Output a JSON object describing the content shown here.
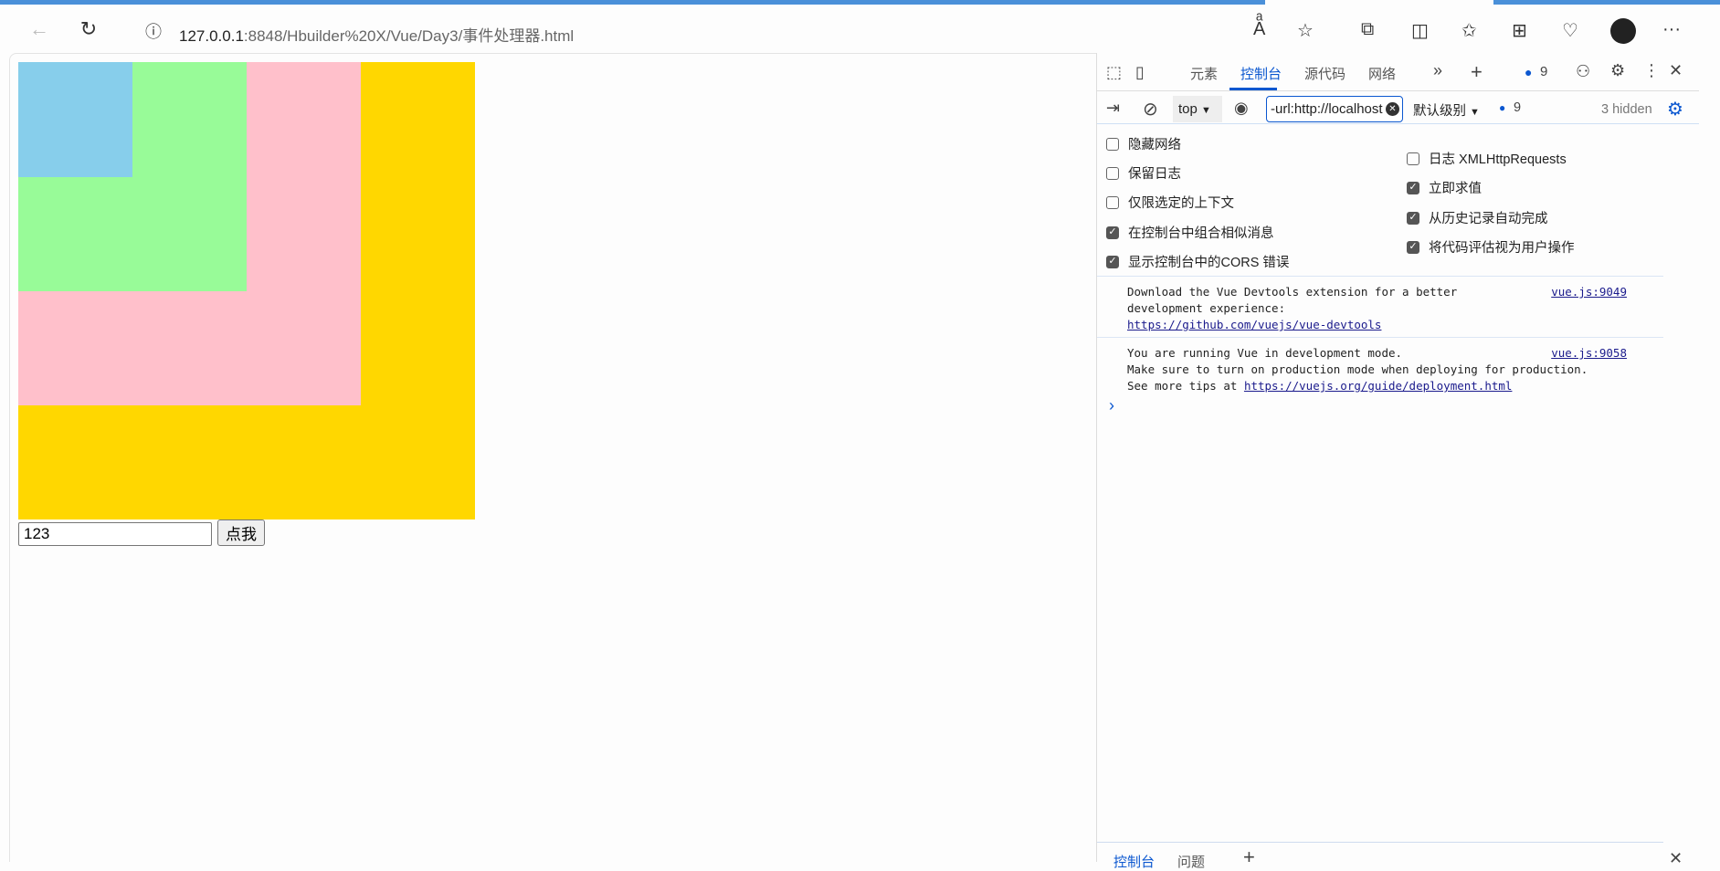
{
  "browser": {
    "url_host": "127.0.0.1",
    "url_rest": ":8848/Hbuilder%20X/Vue/Day3/事件处理器.html"
  },
  "page": {
    "input_value": "123",
    "button_label": "点我",
    "colors": {
      "blue": "#87ceeb",
      "green": "#98fb98",
      "pink": "#ffc0cb",
      "gold": "#ffd700"
    }
  },
  "devtools": {
    "tabs": [
      "元素",
      "控制台",
      "源代码",
      "网络"
    ],
    "message_count": "9",
    "context": "top",
    "filter_value": "-url:http://localhost",
    "level": "默认级别",
    "filter_count": "9",
    "hidden": "3 hidden",
    "settings_left": [
      {
        "label": "隐藏网络",
        "checked": false
      },
      {
        "label": "保留日志",
        "checked": false
      },
      {
        "label": "仅限选定的上下文",
        "checked": false
      },
      {
        "label": "在控制台中组合相似消息",
        "checked": true
      },
      {
        "label": "显示控制台中的CORS 错误",
        "checked": true
      }
    ],
    "settings_right": [
      {
        "label": "日志 XMLHttpRequests",
        "checked": false
      },
      {
        "label": "立即求值",
        "checked": true
      },
      {
        "label": "从历史记录自动完成",
        "checked": true
      },
      {
        "label": "将代码评估视为用户操作",
        "checked": true
      }
    ],
    "messages": [
      {
        "line1": "Download the Vue Devtools extension for a better",
        "line2": "development experience:",
        "link": "https://github.com/vuejs/vue-devtools",
        "source": "vue.js:9049"
      },
      {
        "line1": "You are running Vue in development mode.",
        "line2": "Make sure to turn on production mode when deploying for production.",
        "prefix": "See more tips at ",
        "link": "https://vuejs.org/guide/deployment.html",
        "source": "vue.js:9058"
      }
    ],
    "drawer_tabs": [
      "控制台",
      "问题"
    ]
  }
}
